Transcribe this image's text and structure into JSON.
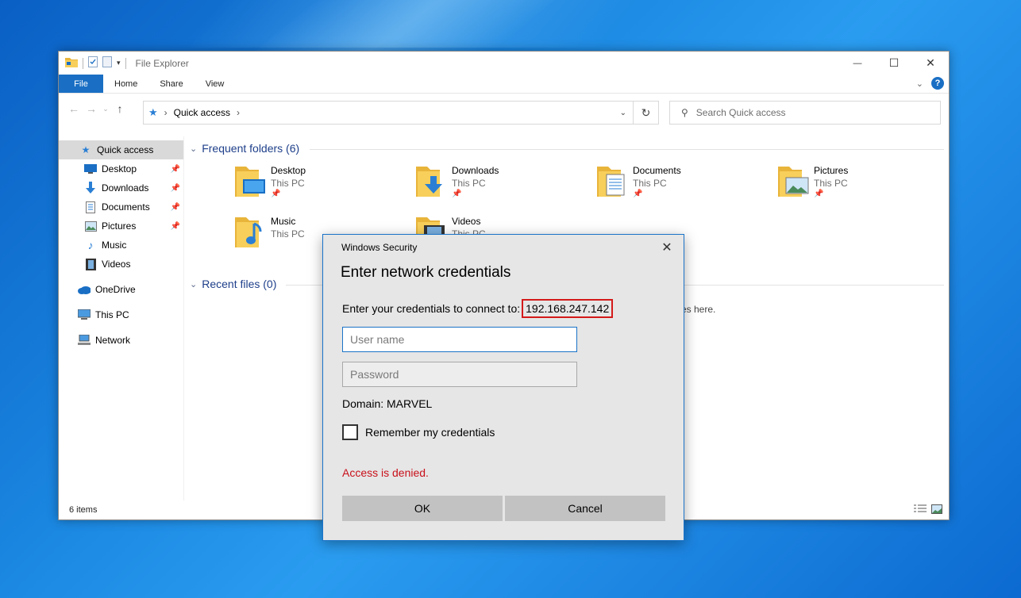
{
  "window": {
    "title": "File Explorer",
    "controls": {
      "minimize": "—",
      "maximize": "☐",
      "close": "✕"
    }
  },
  "ribbon": {
    "tabs": [
      "File",
      "Home",
      "Share",
      "View"
    ],
    "help": "?"
  },
  "address": {
    "breadcrumb": "Quick access",
    "separator": "›",
    "search_placeholder": "Search Quick access"
  },
  "sidebar": {
    "items": [
      {
        "label": "Quick access",
        "icon": "star-icon",
        "selected": true
      },
      {
        "label": "Desktop",
        "icon": "desktop-icon",
        "pinned": true
      },
      {
        "label": "Downloads",
        "icon": "download-icon",
        "pinned": true
      },
      {
        "label": "Documents",
        "icon": "documents-icon",
        "pinned": true
      },
      {
        "label": "Pictures",
        "icon": "pictures-icon",
        "pinned": true
      },
      {
        "label": "Music",
        "icon": "music-icon"
      },
      {
        "label": "Videos",
        "icon": "videos-icon"
      },
      {
        "label": "OneDrive",
        "icon": "cloud-icon"
      },
      {
        "label": "This PC",
        "icon": "computer-icon"
      },
      {
        "label": "Network",
        "icon": "network-icon"
      }
    ]
  },
  "content": {
    "frequent_title": "Frequent folders (6)",
    "recent_title": "Recent files (0)",
    "recent_empty": "es here.",
    "folders": [
      {
        "name": "Desktop",
        "location": "This PC",
        "pinned": true
      },
      {
        "name": "Downloads",
        "location": "This PC",
        "pinned": true
      },
      {
        "name": "Documents",
        "location": "This PC",
        "pinned": true
      },
      {
        "name": "Pictures",
        "location": "This PC",
        "pinned": true
      },
      {
        "name": "Music",
        "location": "This PC",
        "pinned": false
      },
      {
        "name": "Videos",
        "location": "This PC",
        "pinned": false
      }
    ]
  },
  "status": {
    "items": "6 items"
  },
  "dialog": {
    "title": "Windows Security",
    "heading": "Enter network credentials",
    "prompt": "Enter your credentials to connect to:",
    "target": "192.168.247.142",
    "username_placeholder": "User name",
    "password_placeholder": "Password",
    "domain": "Domain: MARVEL",
    "remember": "Remember my credentials",
    "error": "Access is denied.",
    "ok": "OK",
    "cancel": "Cancel",
    "close": "✕"
  },
  "colors": {
    "accent": "#1a6fc4",
    "error": "#c8101a",
    "highlight_border": "#d41a1a"
  }
}
